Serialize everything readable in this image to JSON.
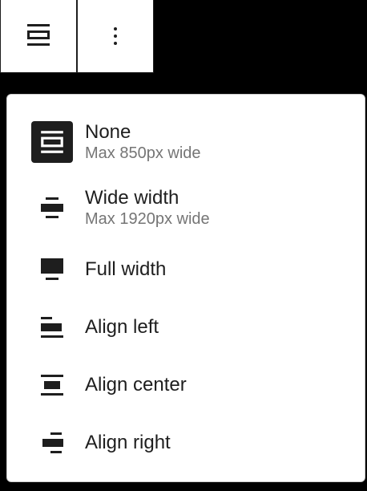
{
  "toolbar": {
    "align_icon": "align-none-icon",
    "more_icon": "more-vertical-icon"
  },
  "menu": {
    "items": [
      {
        "label": "None",
        "sub": "Max 850px wide",
        "icon": "align-none-icon",
        "selected": true
      },
      {
        "label": "Wide width",
        "sub": "Max 1920px wide",
        "icon": "align-wide-icon",
        "selected": false
      },
      {
        "label": "Full width",
        "sub": "",
        "icon": "align-full-width-icon",
        "selected": false
      },
      {
        "label": "Align left",
        "sub": "",
        "icon": "align-left-icon",
        "selected": false
      },
      {
        "label": "Align center",
        "sub": "",
        "icon": "align-center-icon",
        "selected": false
      },
      {
        "label": "Align right",
        "sub": "",
        "icon": "align-right-icon",
        "selected": false
      }
    ]
  },
  "colors": {
    "selected_bg": "#1e1e1e",
    "sub_text": "#757575",
    "backdrop": "#000000"
  }
}
